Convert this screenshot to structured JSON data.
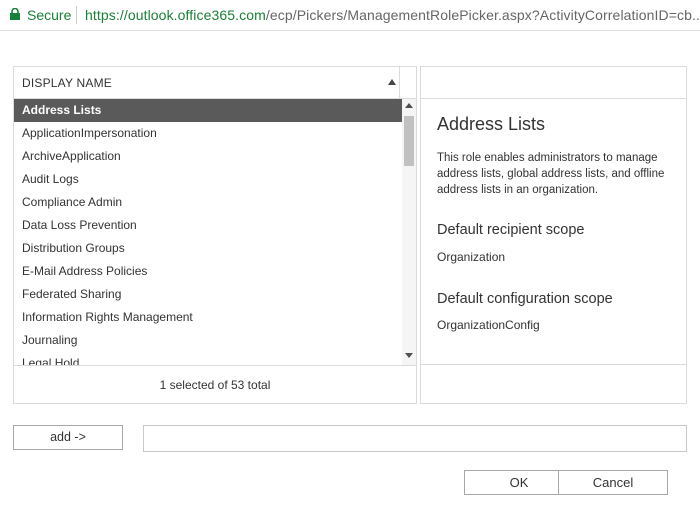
{
  "address_bar": {
    "secure_label": "Secure",
    "url_host": "https://outlook.office365.com",
    "url_path": "/ecp/Pickers/ManagementRolePicker.aspx?ActivityCorrelationID=cb..."
  },
  "list": {
    "header": "DISPLAY NAME",
    "items": [
      "Address Lists",
      "ApplicationImpersonation",
      "ArchiveApplication",
      "Audit Logs",
      "Compliance Admin",
      "Data Loss Prevention",
      "Distribution Groups",
      "E-Mail Address Policies",
      "Federated Sharing",
      "Information Rights Management",
      "Journaling",
      "Legal Hold"
    ],
    "selected_item": "Address Lists",
    "footer": "1 selected of 53 total"
  },
  "details": {
    "title": "Address Lists",
    "description": "This role enables administrators to manage address lists, global address lists, and offline address lists in an organization.",
    "recipient_scope_heading": "Default recipient scope",
    "recipient_scope_value": "Organization",
    "config_scope_heading": "Default configuration scope",
    "config_scope_value": "OrganizationConfig"
  },
  "actions": {
    "add_label": "add ->",
    "add_value": "",
    "ok_label": "OK",
    "cancel_label": "Cancel"
  },
  "colors": {
    "secure_green": "#188038",
    "selected_row_bg": "#5a5a5a",
    "border": "#dadada"
  }
}
